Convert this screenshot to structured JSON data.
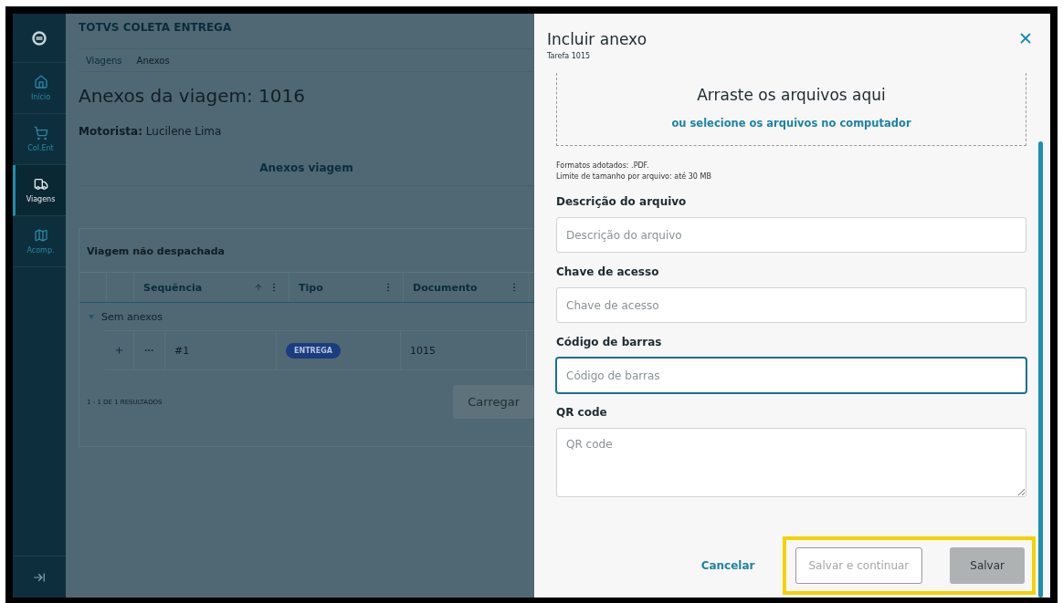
{
  "sidebar": {
    "items": [
      {
        "label": "Início",
        "selected": false
      },
      {
        "label": "Col.Ent",
        "selected": false
      },
      {
        "label": "Viagens",
        "selected": true
      },
      {
        "label": "Acomp.",
        "selected": false
      }
    ]
  },
  "app_title": "TOTVS COLETA ENTREGA",
  "breadcrumb": [
    "Viagens",
    "Anexos"
  ],
  "heading": "Anexos da viagem: 1016",
  "driver": "**Motorista:** Lucilene Lima",
  "tabs": [
    {
      "label": "Anexos viagem",
      "selected": true
    }
  ],
  "card": {
    "title": "Viagem não despachada",
    "columns": [
      {
        "label": "Sequência",
        "sorted": true
      },
      {
        "label": "Tipo",
        "sorted": false
      },
      {
        "label": "Documento",
        "sorted": false
      }
    ],
    "groups": [
      {
        "label": "Sem anexos",
        "expanded": true,
        "rows": [
          {
            "sequence": "#1",
            "type": "ENTREGA",
            "document": "1015"
          }
        ]
      }
    ],
    "results": "1 - 1 DE 1 RESULTADOS",
    "load_more": "Carregar"
  },
  "drawer": {
    "title": "Incluir anexo",
    "subtitle": "Tarefa 1015",
    "dropzone": {
      "title": "Arraste os arquivos aqui",
      "link": "ou selecione os arquivos no computador"
    },
    "info": [
      "Formatos adotados: .PDF.",
      "Limite de tamanho por arquivo: até 30 MB"
    ],
    "fields": [
      {
        "kind": "input",
        "label": "Descrição do arquivo",
        "placeholder": "Descrição do arquivo",
        "focused": false
      },
      {
        "kind": "input",
        "label": "Chave de acesso",
        "placeholder": "Chave de acesso",
        "focused": false
      },
      {
        "kind": "input",
        "label": "Código de barras",
        "placeholder": "Código de barras",
        "focused": true
      },
      {
        "kind": "textarea",
        "label": "QR code",
        "placeholder": "QR code",
        "focused": false
      }
    ],
    "buttons": [
      {
        "kind": "link",
        "label": "Cancelar",
        "disabled": false,
        "highlighted": false
      },
      {
        "kind": "outline",
        "label": "Salvar e continuar",
        "disabled": true,
        "highlighted": true
      },
      {
        "kind": "primary",
        "label": "Salvar",
        "disabled": true,
        "highlighted": true
      }
    ]
  }
}
